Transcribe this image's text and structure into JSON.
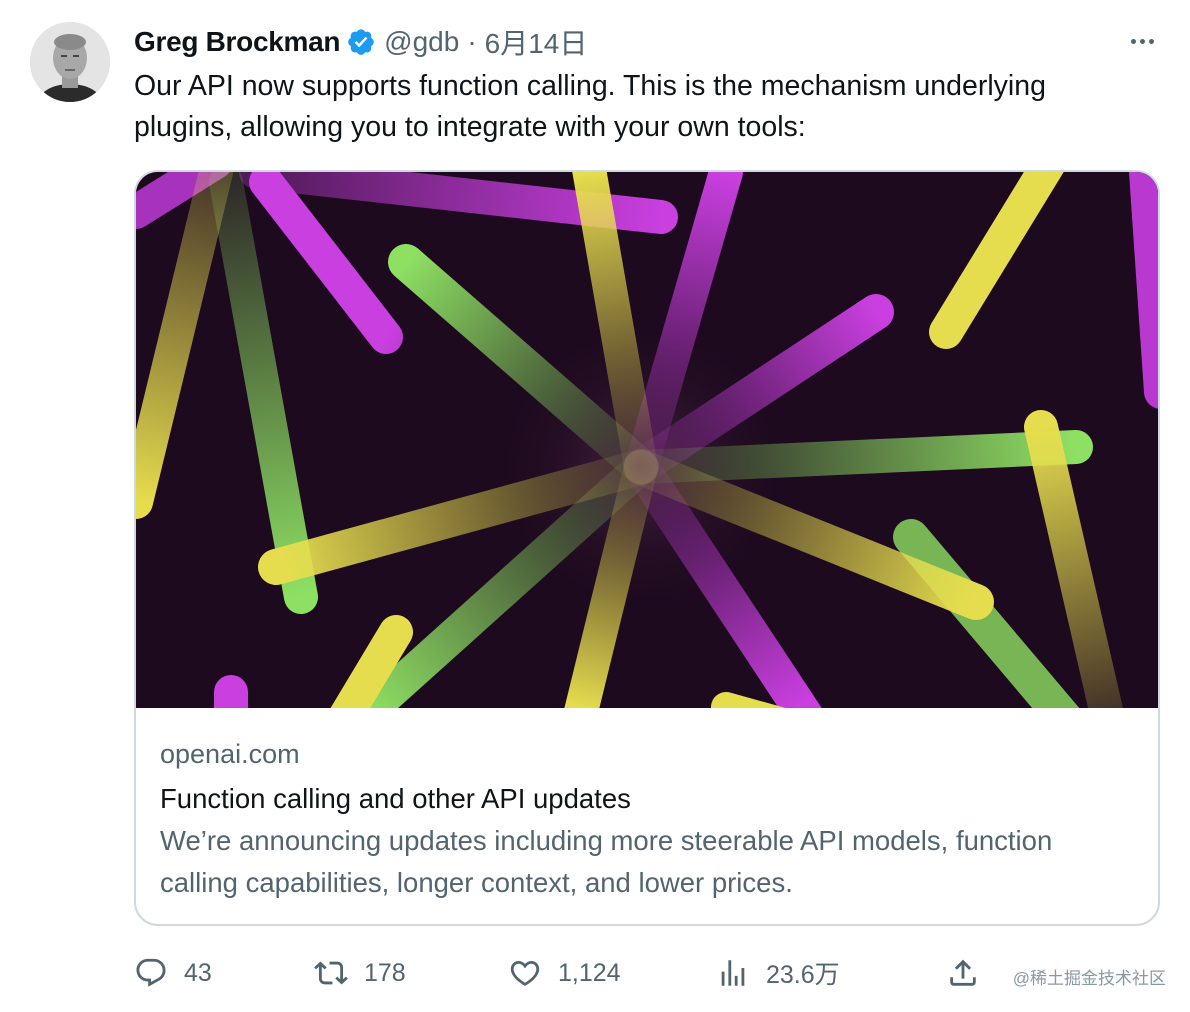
{
  "tweet": {
    "author_name": "Greg Brockman",
    "handle": "@gdb",
    "separator": "·",
    "date": "6月14日",
    "text": "Our API now supports function calling. This is the mechanism underlying plugins, allowing you to integrate with your own tools:"
  },
  "card": {
    "domain": "openai.com",
    "title": "Function calling and other API updates",
    "description": "We’re announcing updates including more steerable API models, function calling capabilities, longer context, and lower prices."
  },
  "actions": {
    "reply_count": "43",
    "retweet_count": "178",
    "like_count": "1,124",
    "view_count": "23.6万"
  },
  "icons": {
    "verified": "verified-badge-icon",
    "more": "more-horizontal-icon",
    "reply": "reply-icon",
    "retweet": "retweet-icon",
    "like": "heart-icon",
    "views": "views-icon",
    "share": "share-icon"
  },
  "colors": {
    "verified_blue": "#1d9bf0",
    "text_primary": "#0f1419",
    "text_secondary": "#536471",
    "card_border": "#cfd9de",
    "image_background": "#1e0a1f",
    "stick_magenta": "#c93fe0",
    "stick_yellow": "#e6dd4e",
    "stick_green": "#8ee063"
  },
  "watermark": "@稀土掘金技术社区"
}
